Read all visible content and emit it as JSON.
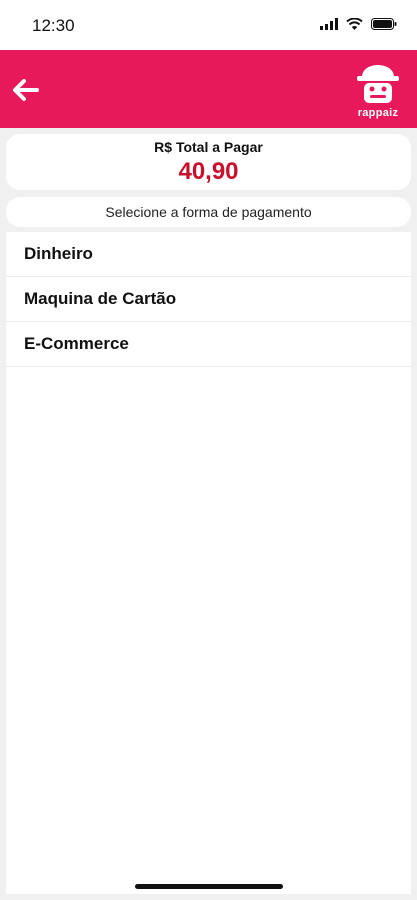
{
  "status": {
    "time": "12:30"
  },
  "header": {
    "logo_text": "rappaiz",
    "back_icon": "arrow-left-icon"
  },
  "total": {
    "label": "R$ Total a Pagar",
    "value": "40,90"
  },
  "hint": "Selecione a forma de pagamento",
  "payment_methods": [
    {
      "label": "Dinheiro"
    },
    {
      "label": "Maquina de Cartão"
    },
    {
      "label": "E-Commerce"
    }
  ],
  "colors": {
    "brand": "#e8195a",
    "total_value": "#c8102e"
  }
}
